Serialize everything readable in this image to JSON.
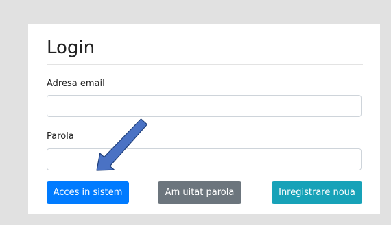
{
  "login": {
    "title": "Login",
    "email_label": "Adresa email",
    "email_value": "",
    "password_label": "Parola",
    "password_value": "",
    "login_button": "Acces in sistem",
    "forgot_button": "Am uitat parola",
    "register_button": "Inregistrare noua"
  },
  "colors": {
    "background": "#e1e1e1",
    "primary": "#007bff",
    "secondary": "#6c757d",
    "info": "#17a2b8",
    "annotation_arrow": "#4a72c4"
  },
  "annotation": {
    "icon": "pointer-arrow-icon"
  }
}
